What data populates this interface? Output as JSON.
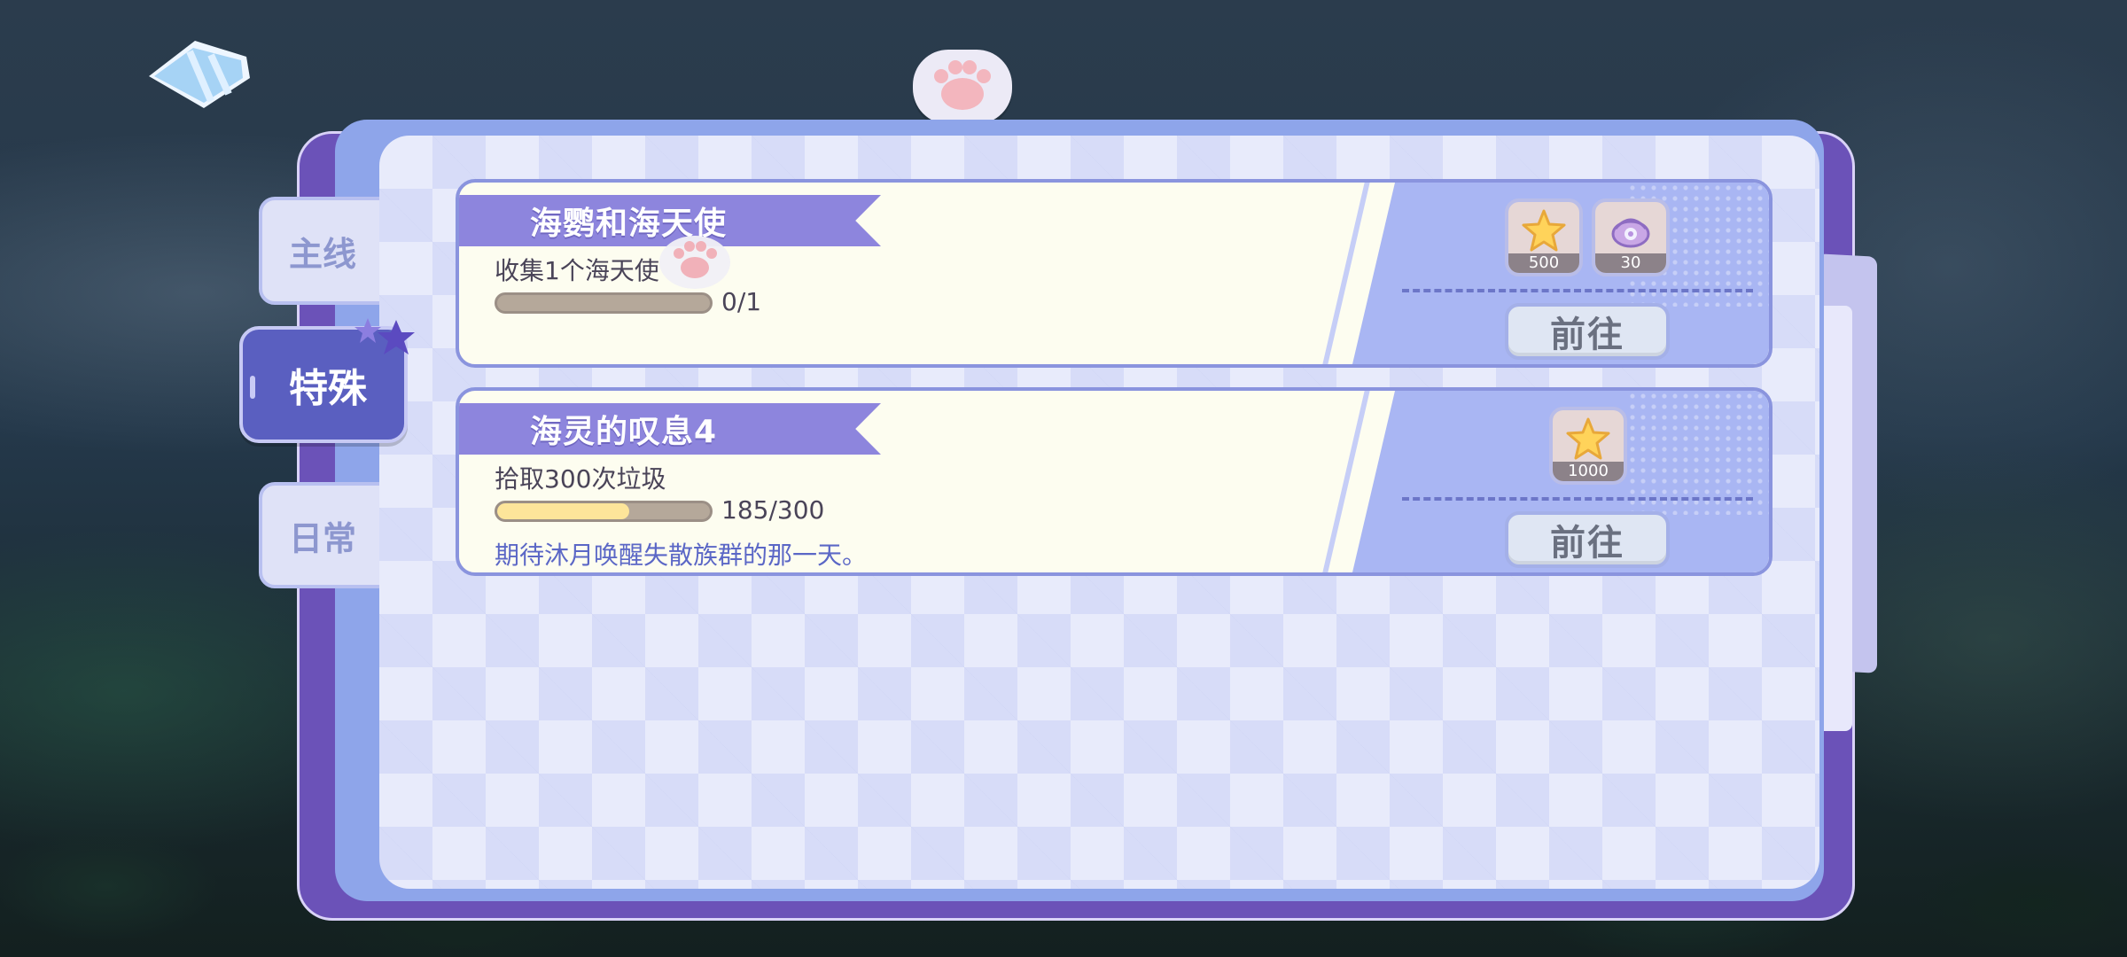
{
  "tabs": {
    "main": "主线",
    "special": "特殊",
    "daily": "日常"
  },
  "quests": [
    {
      "title": "海鹦和海天使",
      "description": "收集1个海天使",
      "progress": "0/1",
      "progress_fraction": 0,
      "flavor": "",
      "rewards": [
        {
          "icon": "star-icon",
          "count": "500"
        },
        {
          "icon": "shell-icon",
          "count": "30"
        }
      ],
      "button": "前往"
    },
    {
      "title": "海灵的叹息4",
      "description": "拾取300次垃圾",
      "progress": "185/300",
      "progress_fraction": 0.617,
      "flavor": "期待沐月唤醒失散族群的那一天。",
      "rewards": [
        {
          "icon": "star-icon",
          "count": "1000"
        }
      ],
      "button": "前往"
    }
  ],
  "colors": {
    "accent": "#8d85dd",
    "tab_active": "#5a5fc0",
    "panel_right": "#a9b6f3",
    "progress_fill": "#fde59a"
  }
}
